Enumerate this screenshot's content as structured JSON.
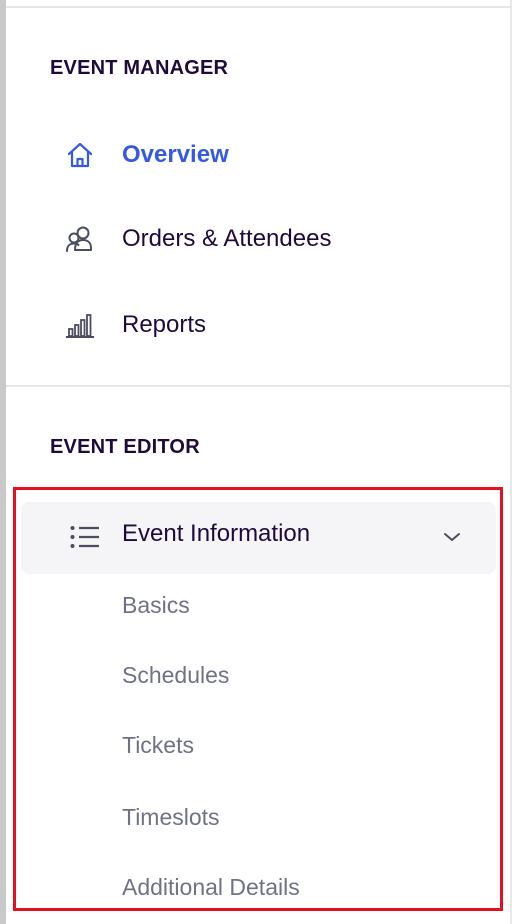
{
  "sidebar": {
    "event_manager": {
      "heading": "EVENT MANAGER",
      "items": [
        {
          "label": "Overview",
          "icon": "home-icon",
          "active": true
        },
        {
          "label": "Orders & Attendees",
          "icon": "people-icon",
          "active": false
        },
        {
          "label": "Reports",
          "icon": "bar-chart-icon",
          "active": false
        }
      ]
    },
    "event_editor": {
      "heading": "EVENT EDITOR",
      "group": {
        "label": "Event Information",
        "icon": "list-icon",
        "expanded": true,
        "chevron": "chevron-down-icon",
        "subitems": [
          {
            "label": "Basics"
          },
          {
            "label": "Schedules"
          },
          {
            "label": "Tickets"
          },
          {
            "label": "Timeslots"
          },
          {
            "label": "Additional Details"
          }
        ]
      }
    }
  },
  "colors": {
    "active": "#3659e3",
    "text": "#1e0a3c",
    "muted": "#6f7287",
    "highlight_border": "#e3101e",
    "group_background": "#f5f5f7"
  }
}
